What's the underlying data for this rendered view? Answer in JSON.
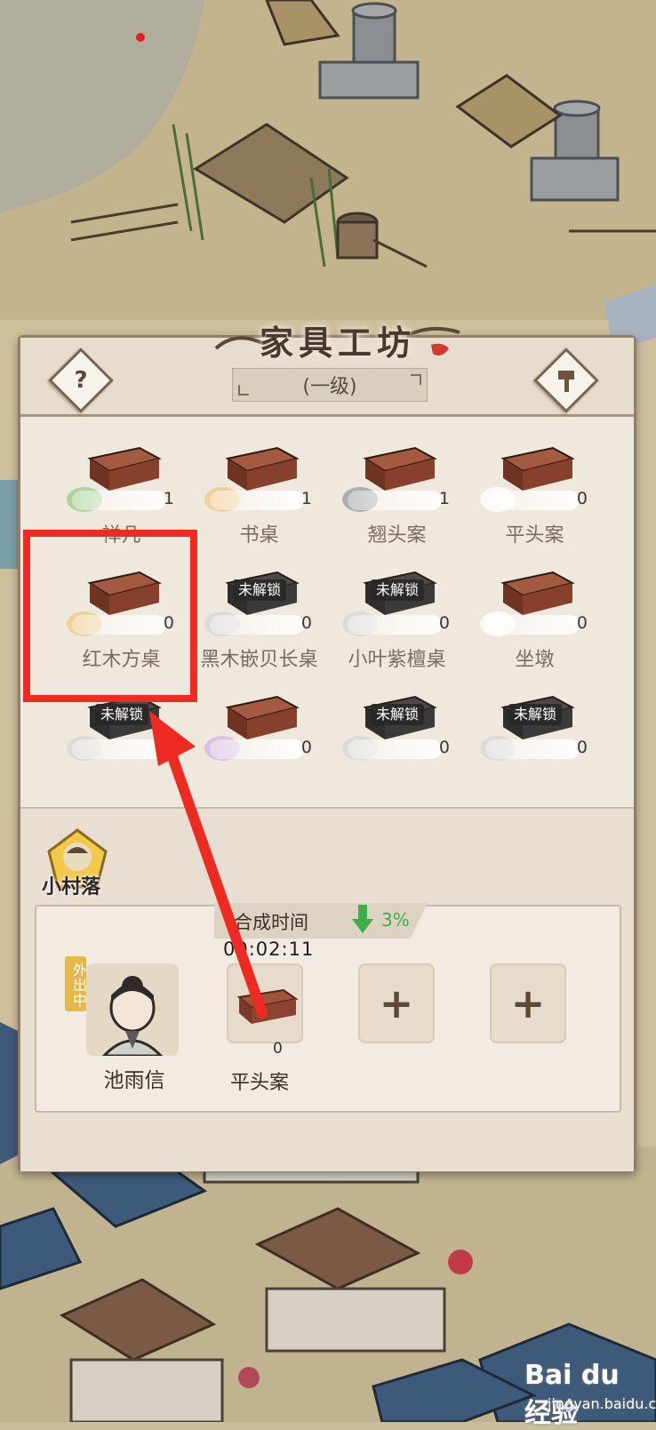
{
  "workshop": {
    "title": "家具工坊",
    "level": "(一级)",
    "help_icon": "question-icon",
    "upgrade_icon": "hammer-icon"
  },
  "items": [
    {
      "name": "禅几",
      "count": "1",
      "locked": false,
      "blob": "#9fd08e"
    },
    {
      "name": "书桌",
      "count": "1",
      "locked": false,
      "blob": "#f0c98a"
    },
    {
      "name": "翘头案",
      "count": "1",
      "locked": false,
      "blob": "#9aa0a6"
    },
    {
      "name": "平头案",
      "count": "0",
      "locked": false,
      "blob": "#ffffff"
    },
    {
      "name": "红木方桌",
      "count": "0",
      "locked": false,
      "blob": "#f0c98a"
    },
    {
      "name": "黑木嵌贝长桌",
      "count": "0",
      "locked": true,
      "lock_label": "未解锁",
      "blob": "#d7d7d7"
    },
    {
      "name": "小叶紫檀桌",
      "count": "0",
      "locked": true,
      "lock_label": "未解锁",
      "blob": "#d7d7d7"
    },
    {
      "name": "坐墩",
      "count": "0",
      "locked": false,
      "blob": "#ffffff"
    },
    {
      "name": "",
      "count": "",
      "locked": true,
      "lock_label": "未解锁",
      "blob": "#d7d7d7"
    },
    {
      "name": "",
      "count": "0",
      "locked": false,
      "blob": "#d6b6e6"
    },
    {
      "name": "",
      "count": "0",
      "locked": true,
      "lock_label": "未解锁",
      "blob": "#d7d7d7"
    },
    {
      "name": "",
      "count": "0",
      "locked": true,
      "lock_label": "未解锁",
      "blob": "#d7d7d7"
    }
  ],
  "village": {
    "label": "小村落"
  },
  "crafting": {
    "time_label": "合成时间",
    "time_bonus": "3%",
    "timer": "00:02:11",
    "worker_name": "池雨信",
    "worker_status": "外出中",
    "item_name": "平头案",
    "item_count": "0"
  },
  "colors": {
    "highlight": "#ee2b22",
    "bonus": "#3fae4a"
  },
  "watermark": {
    "logo": "Bai du 经验",
    "site": "jingyan.baidu.com"
  }
}
